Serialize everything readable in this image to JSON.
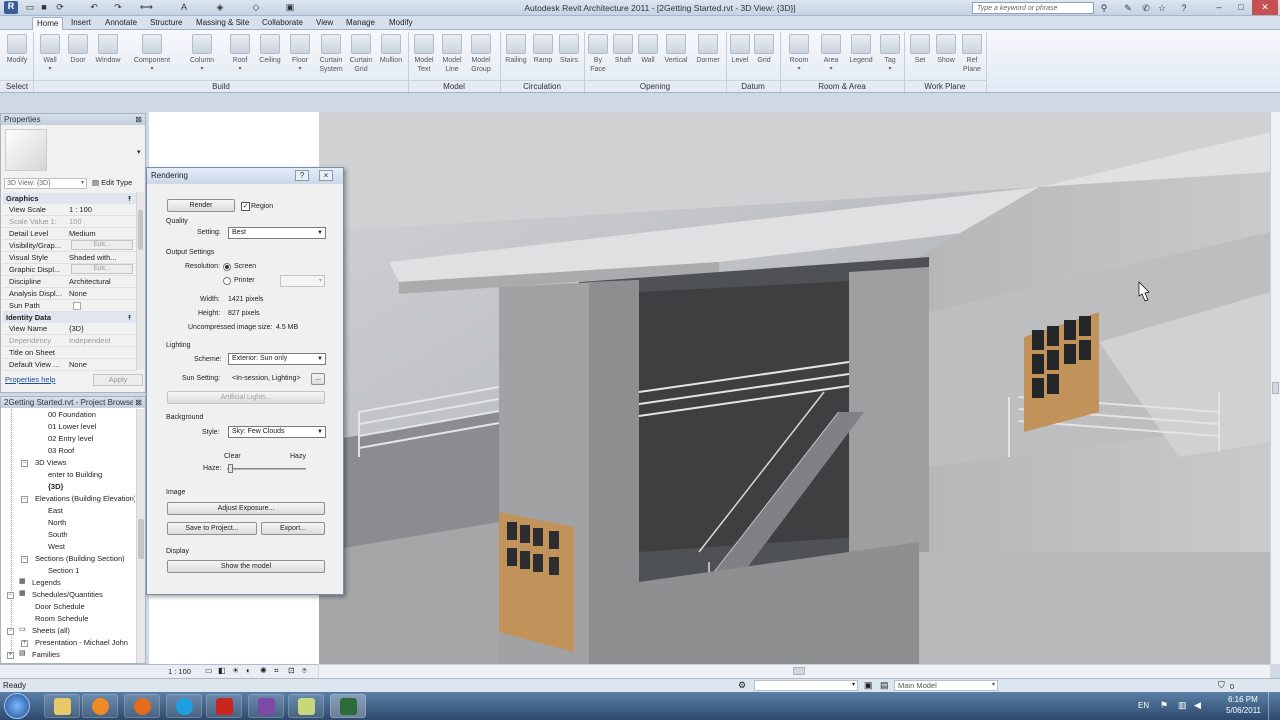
{
  "app": {
    "title": "Autodesk Revit Architecture 2011 - [2Getting Started.rvt - 3D View: {3D}]",
    "search_placeholder": "Type a keyword or phrase"
  },
  "tabs": [
    "Home",
    "Insert",
    "Annotate",
    "Structure",
    "Massing & Site",
    "Collaborate",
    "View",
    "Manage",
    "Modify"
  ],
  "ribbon": {
    "buttons": [
      {
        "label": "Modify",
        "label2": ""
      },
      {
        "label": "Wall",
        "label2": ""
      },
      {
        "label": "Door",
        "label2": ""
      },
      {
        "label": "Window",
        "label2": ""
      },
      {
        "label": "Component",
        "label2": ""
      },
      {
        "label": "Column",
        "label2": ""
      },
      {
        "label": "Roof",
        "label2": ""
      },
      {
        "label": "Ceiling",
        "label2": ""
      },
      {
        "label": "Floor",
        "label2": ""
      },
      {
        "label": "Curtain",
        "label2": "System"
      },
      {
        "label": "Curtain",
        "label2": "Grid"
      },
      {
        "label": "Mullion",
        "label2": ""
      },
      {
        "label": "Model",
        "label2": "Text"
      },
      {
        "label": "Model",
        "label2": "Line"
      },
      {
        "label": "Model",
        "label2": "Group"
      },
      {
        "label": "Railing",
        "label2": ""
      },
      {
        "label": "Ramp",
        "label2": ""
      },
      {
        "label": "Stairs",
        "label2": ""
      },
      {
        "label": "By",
        "label2": "Face"
      },
      {
        "label": "Shaft",
        "label2": ""
      },
      {
        "label": "Wall",
        "label2": ""
      },
      {
        "label": "Vertical",
        "label2": ""
      },
      {
        "label": "Dormer",
        "label2": ""
      },
      {
        "label": "Level",
        "label2": ""
      },
      {
        "label": "Grid",
        "label2": ""
      },
      {
        "label": "Room",
        "label2": ""
      },
      {
        "label": "Area",
        "label2": ""
      },
      {
        "label": "Legend",
        "label2": ""
      },
      {
        "label": "Tag",
        "label2": ""
      },
      {
        "label": "Set",
        "label2": ""
      },
      {
        "label": "Show",
        "label2": ""
      },
      {
        "label": "Ref",
        "label2": "Plane"
      }
    ],
    "panels": [
      "Select",
      "Build",
      "Model",
      "Circulation",
      "Opening",
      "Datum",
      "Room & Area",
      "Work Plane"
    ]
  },
  "properties": {
    "header": "Properties",
    "type_selector": "3D View: {3D}",
    "edit_type": "Edit Type",
    "group_graphics": "Graphics",
    "group_identity": "Identity Data",
    "rows": [
      {
        "k": "View Scale",
        "v": "1 : 100"
      },
      {
        "k": "Scale Value    1:",
        "v": "100"
      },
      {
        "k": "Detail Level",
        "v": "Medium"
      },
      {
        "k": "Visibility/Grap...",
        "v": "Edit..."
      },
      {
        "k": "Visual Style",
        "v": "Shaded with..."
      },
      {
        "k": "Graphic Displ...",
        "v": "Edit..."
      },
      {
        "k": "Discipline",
        "v": "Architectural"
      },
      {
        "k": "Analysis Displ...",
        "v": "None"
      },
      {
        "k": "Sun Path",
        "v": ""
      },
      {
        "k": "View Name",
        "v": "{3D}"
      },
      {
        "k": "Dependency",
        "v": "Independent"
      },
      {
        "k": "Title on Sheet",
        "v": ""
      },
      {
        "k": "Default View ...",
        "v": "None"
      }
    ],
    "help": "Properties help",
    "apply": "Apply"
  },
  "browser": {
    "header": "2Getting Started.rvt - Project Browser",
    "items": [
      {
        "label": "00 Foundation"
      },
      {
        "label": "01 Lower level"
      },
      {
        "label": "02 Entry level"
      },
      {
        "label": "03 Roof"
      },
      {
        "label": "3D Views"
      },
      {
        "label": "enter to Building"
      },
      {
        "label": "{3D}"
      },
      {
        "label": "Elevations (Building Elevation)"
      },
      {
        "label": "East"
      },
      {
        "label": "North"
      },
      {
        "label": "South"
      },
      {
        "label": "West"
      },
      {
        "label": "Sections (Building Section)"
      },
      {
        "label": "Section 1"
      },
      {
        "label": "Legends"
      },
      {
        "label": "Schedules/Quantities"
      },
      {
        "label": "Door Schedule"
      },
      {
        "label": "Room Schedule"
      },
      {
        "label": "Sheets (all)"
      },
      {
        "label": "Presentation - Michael John"
      },
      {
        "label": "Families"
      }
    ]
  },
  "view_control": {
    "scale": "1 : 100"
  },
  "status": {
    "left": "Ready",
    "model": "Main Model",
    "filter": "0"
  },
  "rendering": {
    "title": "Rendering",
    "render_btn": "Render",
    "region_label": "Region",
    "region_checked": true,
    "quality_label": "Quality",
    "setting_label": "Setting:",
    "setting_value": "Best",
    "output_label": "Output Settings",
    "resolution_label": "Resolution:",
    "screen_label": "Screen",
    "printer_label": "Printer",
    "width_label": "Width:",
    "width_value": "1421 pixels",
    "height_label": "Height:",
    "height_value": "827 pixels",
    "size_label": "Uncompressed image size:",
    "size_value": "4.5 MB",
    "lighting_label": "Lighting",
    "scheme_label": "Scheme:",
    "scheme_value": "Exterior: Sun only",
    "sun_label": "Sun Setting:",
    "sun_value": "<In-session, Lighting>",
    "sun_more": "...",
    "artificial_btn": "Artificial Lights...",
    "background_label": "Background",
    "style_label": "Style:",
    "style_value": "Sky: Few Clouds",
    "clear_label": "Clear",
    "hazy_label": "Hazy",
    "haze_label": "Haze:",
    "haze_level": 0.02,
    "image_label": "Image",
    "adjust_btn": "Adjust Exposure...",
    "save_btn": "Save to Project...",
    "export_btn": "Export...",
    "display_label": "Display",
    "show_btn": "Show the model",
    "help_btn": "?",
    "close_btn": "×"
  },
  "tray": {
    "lang": "EN",
    "time": "6:16 PM",
    "date": "5/06/2011"
  }
}
